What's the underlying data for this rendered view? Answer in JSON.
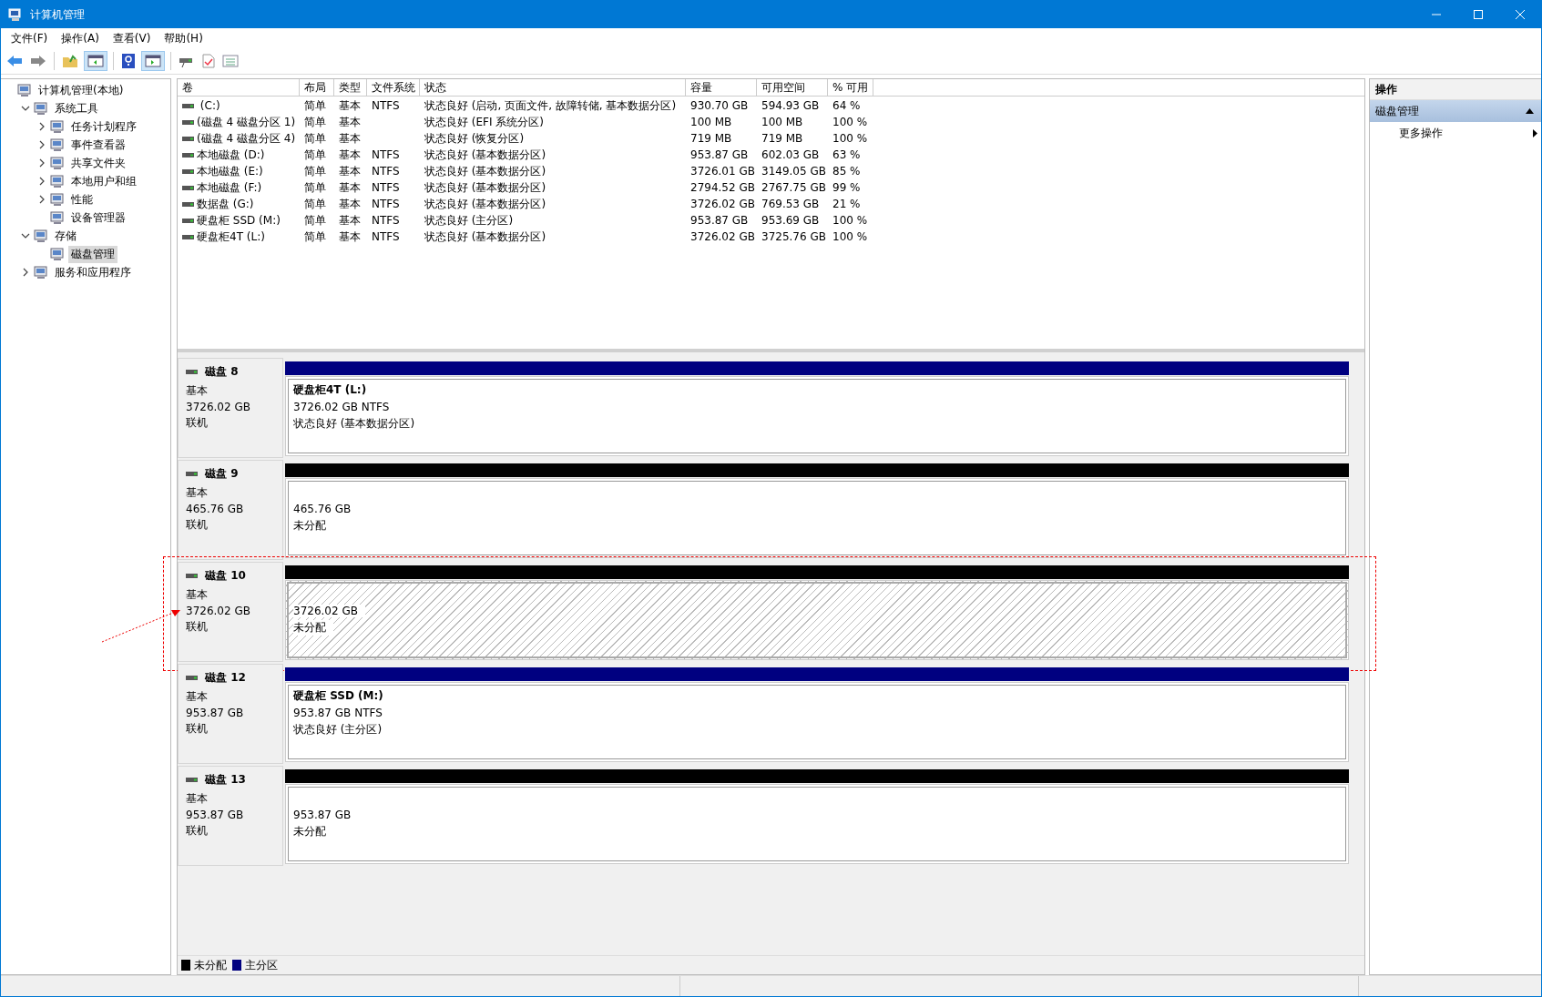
{
  "window": {
    "title": "计算机管理"
  },
  "menu": [
    "文件(F)",
    "操作(A)",
    "查看(V)",
    "帮助(H)"
  ],
  "tree": [
    {
      "label": "计算机管理(本地)",
      "selected": false,
      "children": [
        {
          "label": "系统工具",
          "expanded": true,
          "selected": false,
          "children": [
            {
              "label": "任务计划程序",
              "expanded": false,
              "selected": false
            },
            {
              "label": "事件查看器",
              "expanded": false,
              "selected": false
            },
            {
              "label": "共享文件夹",
              "expanded": false,
              "selected": false
            },
            {
              "label": "本地用户和组",
              "expanded": false,
              "selected": false
            },
            {
              "label": "性能",
              "expanded": false,
              "selected": false
            },
            {
              "label": "设备管理器",
              "selected": false
            }
          ]
        },
        {
          "label": "存储",
          "expanded": true,
          "selected": false,
          "children": [
            {
              "label": "磁盘管理",
              "selected": true
            }
          ]
        },
        {
          "label": "服务和应用程序",
          "expanded": false,
          "selected": false
        }
      ]
    }
  ],
  "table": {
    "columns": [
      "卷",
      "布局",
      "类型",
      "文件系统",
      "状态",
      "容量",
      "可用空间",
      "% 可用"
    ],
    "rows": [
      [
        " (C:)",
        "简单",
        "基本",
        "NTFS",
        "状态良好 (启动, 页面文件, 故障转储, 基本数据分区)",
        "930.70 GB",
        "594.93 GB",
        "64 %"
      ],
      [
        "(磁盘 4 磁盘分区 1)",
        "简单",
        "基本",
        "",
        "状态良好 (EFI 系统分区)",
        "100 MB",
        "100 MB",
        "100 %"
      ],
      [
        "(磁盘 4 磁盘分区 4)",
        "简单",
        "基本",
        "",
        "状态良好 (恢复分区)",
        "719 MB",
        "719 MB",
        "100 %"
      ],
      [
        "本地磁盘 (D:)",
        "简单",
        "基本",
        "NTFS",
        "状态良好 (基本数据分区)",
        "953.87 GB",
        "602.03 GB",
        "63 %"
      ],
      [
        "本地磁盘 (E:)",
        "简单",
        "基本",
        "NTFS",
        "状态良好 (基本数据分区)",
        "3726.01 GB",
        "3149.05 GB",
        "85 %"
      ],
      [
        "本地磁盘 (F:)",
        "简单",
        "基本",
        "NTFS",
        "状态良好 (基本数据分区)",
        "2794.52 GB",
        "2767.75 GB",
        "99 %"
      ],
      [
        "数据盘 (G:)",
        "简单",
        "基本",
        "NTFS",
        "状态良好 (基本数据分区)",
        "3726.02 GB",
        "769.53 GB",
        "21 %"
      ],
      [
        "硬盘柜 SSD (M:)",
        "简单",
        "基本",
        "NTFS",
        "状态良好 (主分区)",
        "953.87 GB",
        "953.69 GB",
        "100 %"
      ],
      [
        "硬盘柜4T (L:)",
        "简单",
        "基本",
        "NTFS",
        "状态良好 (基本数据分区)",
        "3726.02 GB",
        "3725.76 GB",
        "100 %"
      ]
    ]
  },
  "disks": [
    {
      "name": "磁盘 8",
      "type": "基本",
      "size": "3726.02 GB",
      "status": "联机",
      "annotated": false,
      "partition": {
        "kind": "primary",
        "selected": false,
        "title": "硬盘柜4T  (L:)",
        "lines": [
          "3726.02 GB NTFS",
          "状态良好 (基本数据分区)"
        ]
      }
    },
    {
      "name": "磁盘 9",
      "type": "基本",
      "size": "465.76 GB",
      "status": "联机",
      "annotated": false,
      "partition": {
        "kind": "unallocated",
        "selected": false,
        "lines": [
          "465.76 GB",
          "未分配"
        ]
      }
    },
    {
      "name": "磁盘 10",
      "type": "基本",
      "size": "3726.02 GB",
      "status": "联机",
      "annotated": true,
      "partition": {
        "kind": "unallocated",
        "selected": true,
        "lines": [
          "3726.02 GB",
          "未分配"
        ]
      }
    },
    {
      "name": "磁盘 12",
      "type": "基本",
      "size": "953.87 GB",
      "status": "联机",
      "annotated": false,
      "partition": {
        "kind": "primary",
        "selected": false,
        "title": "硬盘柜 SSD  (M:)",
        "lines": [
          "953.87 GB NTFS",
          "状态良好 (主分区)"
        ]
      }
    },
    {
      "name": "磁盘 13",
      "type": "基本",
      "size": "953.87 GB",
      "status": "联机",
      "annotated": false,
      "partition": {
        "kind": "unallocated",
        "selected": false,
        "lines": [
          "953.87 GB",
          "未分配"
        ]
      }
    }
  ],
  "legend": [
    {
      "label": "未分配",
      "color": "#000000"
    },
    {
      "label": "主分区",
      "color": "#000080"
    }
  ],
  "actions": {
    "title": "操作",
    "section": "磁盘管理",
    "items": [
      "更多操作"
    ]
  }
}
